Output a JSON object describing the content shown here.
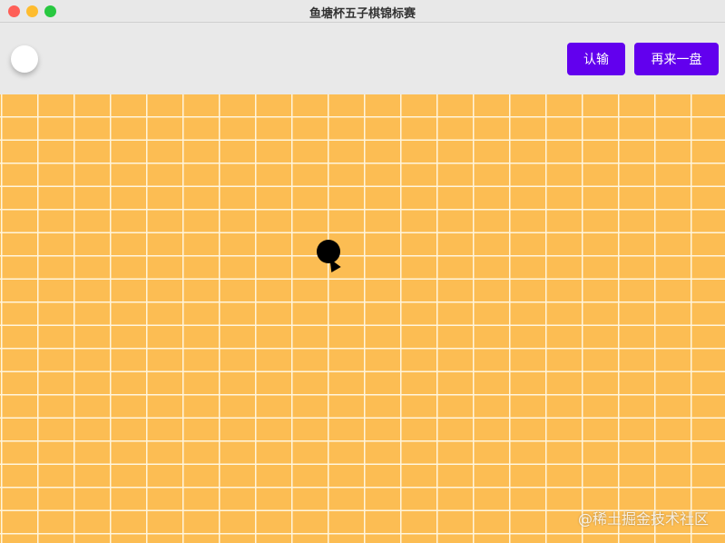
{
  "window": {
    "title": "鱼塘杯五子棋锦标赛"
  },
  "colors": {
    "close": "#fe5f57",
    "minimize": "#febc2e",
    "maximize": "#28c840",
    "board": "#fcbd53",
    "accent": "#6200ee"
  },
  "toolbar": {
    "current_player": "white",
    "resign_label": "认输",
    "restart_label": "再来一盘"
  },
  "board": {
    "stones": [
      {
        "row": 7,
        "col": 9,
        "color": "black"
      }
    ]
  },
  "watermark": "@稀土掘金技术社区"
}
